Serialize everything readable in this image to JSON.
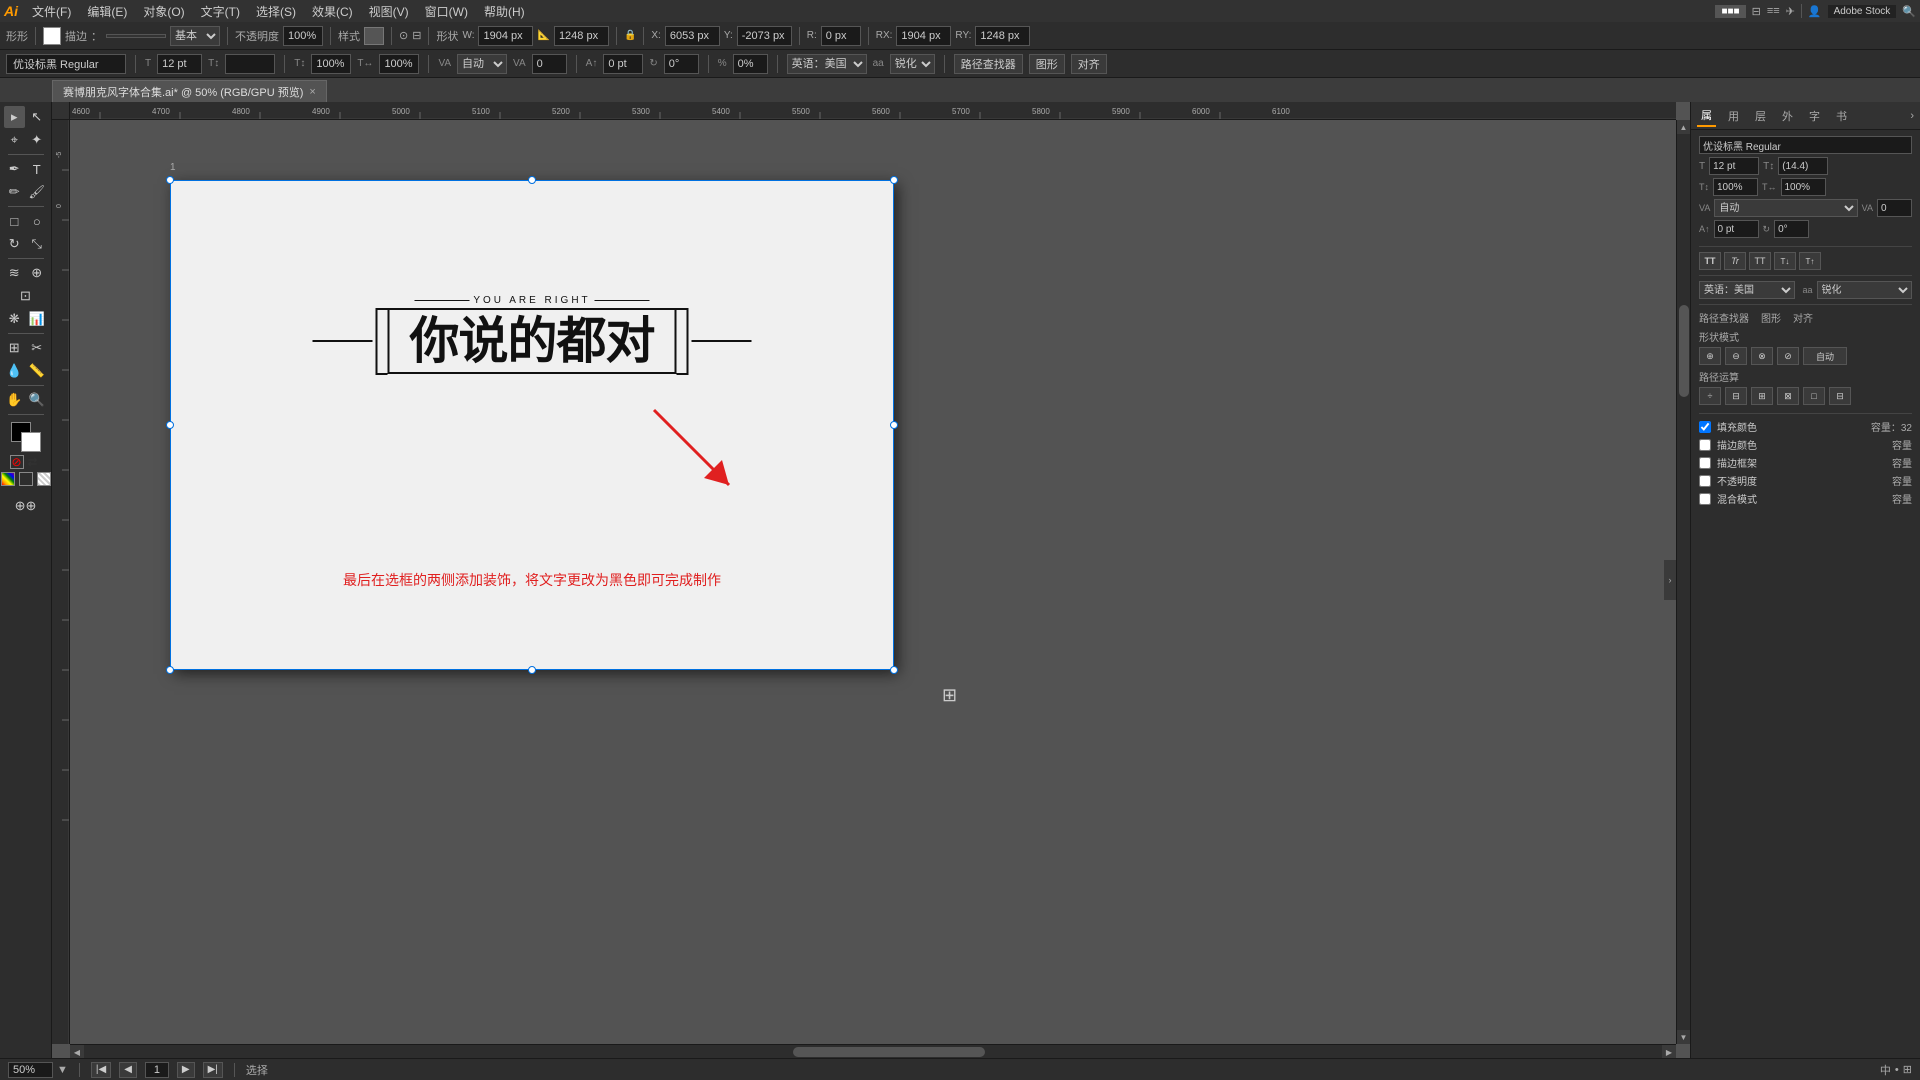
{
  "app": {
    "logo": "Ai",
    "title": "赛博朋克风字体合集.ai* @ 50% (RGB/GPU 预览)"
  },
  "menu": {
    "items": [
      "文件(F)",
      "编辑(E)",
      "对象(O)",
      "文字(T)",
      "选择(S)",
      "效果(C)",
      "视图(V)",
      "窗口(W)",
      "帮助(H)"
    ]
  },
  "toolbar": {
    "stroke_label": "描边",
    "stroke_value": "基本",
    "opacity_label": "不透明度",
    "opacity_value": "100%",
    "style_label": "样式",
    "shape_label": "形状",
    "w_value": "1904 px",
    "h_value": "1248 px",
    "x_label": "X",
    "x_value": "6053 px",
    "y_label": "Y",
    "y_value": "-2073 px",
    "r_value": "1904 px",
    "h2_value": "1248 px"
  },
  "properties_bar": {
    "font_name": "优设标黑 Regular",
    "font_size": "12 pt",
    "scale1": "100%",
    "scale2": "100%",
    "tracking": "自动",
    "kerning": "0",
    "baseline": "0 pt",
    "rotation": "0°",
    "percent": "0%",
    "lang": "英语：美国",
    "aa": "锐化",
    "path_btn": "路径查找器",
    "shape_btn": "图形",
    "align_btn": "对齐",
    "tabs_label": "形状模式",
    "path_ops_label": "路径运算",
    "fill_color_label": "填充颜色",
    "fill_capacity": "容量：32",
    "stroke_color_label": "描边颜色",
    "stroke_frame_label": "描边框架",
    "opacity_label2": "不透明度",
    "blend_label": "混合模式"
  },
  "tab": {
    "filename": "赛博朋克风字体合集.ai* @ 50% (RGB/GPU 预览)",
    "close_label": "×"
  },
  "canvas": {
    "zoom": "50%",
    "artboard_name": "",
    "main_text_top": "YOU ARE RIGHT",
    "main_text_chinese": "你说的都对",
    "instruction_text": "最后在选框的两侧添加装饰，将文字更改为黑色即可完成制作",
    "artboard_number": "1"
  },
  "right_panel": {
    "tabs": [
      "属",
      "用",
      "层",
      "外",
      "字",
      "书"
    ],
    "font_label": "优设标黑 Regular",
    "size_label": "12 pt",
    "leading_label": "(14.4)",
    "tracking_label": "自动",
    "kerning_val": "0",
    "baseline_val": "0 pt",
    "rotation_val": "0°",
    "path_find_label": "路径查找器",
    "shape_label": "图形",
    "align_label": "对齐",
    "shape_mode_label": "形状模式",
    "path_ops_label": "路径运算",
    "fill_color_label": "填充颜色",
    "fill_capacity_val": "32",
    "stroke_color_label": "描边颜色",
    "stroke_capacity_label": "容量",
    "stroke_frame_label": "描边框架",
    "opacity_label": "不透明度",
    "blend_label": "混合模式",
    "auto_label": "自动"
  },
  "status_bar": {
    "zoom": "50%",
    "page_label": "1",
    "nav_prev": "◀",
    "nav_next": "▶",
    "tool_label": "选择"
  },
  "top_right": {
    "stock_label": "Adobe Stock",
    "user_icon": "👤",
    "search_icon": "🔍"
  }
}
